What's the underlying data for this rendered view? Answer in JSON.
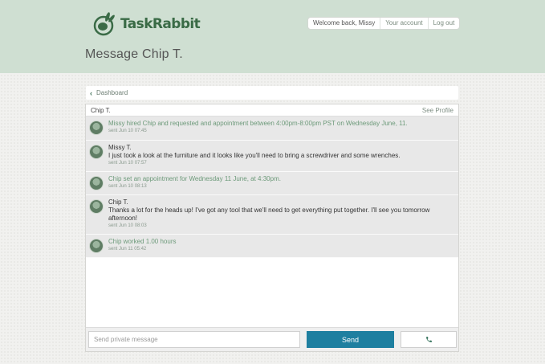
{
  "header": {
    "logo_text": "TaskRabbit",
    "welcome": "Welcome back, Missy",
    "account_link": "Your account",
    "logout_link": "Log out"
  },
  "page_title": "Message Chip T.",
  "breadcrumb": {
    "label": "Dashboard"
  },
  "conversation": {
    "contact_name": "Chip T.",
    "see_profile": "See Profile",
    "messages": [
      {
        "author": "",
        "text": "Missy hired Chip and requested and appointment between 4:00pm-8:00pm PST on Wednesday June, 11.",
        "time": "sent Jun 10 07:45"
      },
      {
        "author": "Missy T.",
        "text": "I just took a look at the furniture and it looks like you'll need to bring a screwdriver and some wrenches.",
        "time": "sent Jun 10 07:57"
      },
      {
        "author": "",
        "text": "Chip set an appointment for Wednesday 11 June, at 4:30pm.",
        "time": "sent Jun 10 08:13"
      },
      {
        "author": "Chip T.",
        "text": "Thanks a lot for the heads up! I've got any tool that we'll need to get everything put together. I'll see you tomorrow afternoon!",
        "time": "sent Jun 10 08:03"
      },
      {
        "author": "",
        "text": "Chip worked 1.00 hours",
        "time": "sent Jun 11 05:42"
      }
    ]
  },
  "composer": {
    "placeholder": "Send private message",
    "send_label": "Send",
    "call_icon": "phone-icon"
  },
  "colors": {
    "header_bg": "#cfdfd2",
    "brand": "#3a6b46",
    "send_button": "#1e7fa0",
    "system_text": "#6d9a7a"
  }
}
